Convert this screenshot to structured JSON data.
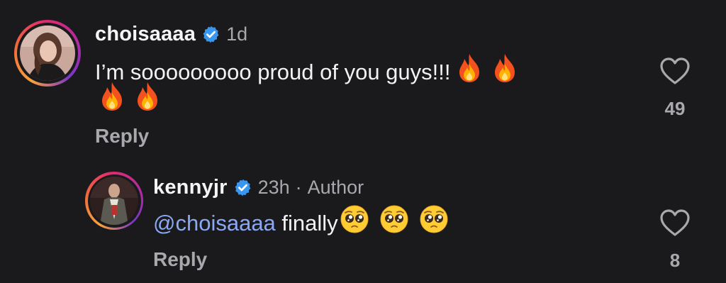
{
  "comments": [
    {
      "username": "choisaaaa",
      "time": "1d",
      "text": "I’m sooooooooo proud of you guys!!!",
      "reply_label": "Reply",
      "likes": "49"
    },
    {
      "username": "kennyjr",
      "time": "23h",
      "separator": "·",
      "author_tag": "Author",
      "mention": "@choisaaaa",
      "text": " finally",
      "reply_label": "Reply",
      "likes": "8"
    }
  ],
  "icons": {
    "verified": "verified-badge-icon",
    "like": "heart-icon",
    "fire_emoji": "🔥",
    "pleading_emoji": "🥺"
  },
  "colors": {
    "background": "#1a1a1c",
    "verified_blue": "#3897f0",
    "mention_blue": "#8ba8f5",
    "secondary_text": "#a8a8ad"
  }
}
